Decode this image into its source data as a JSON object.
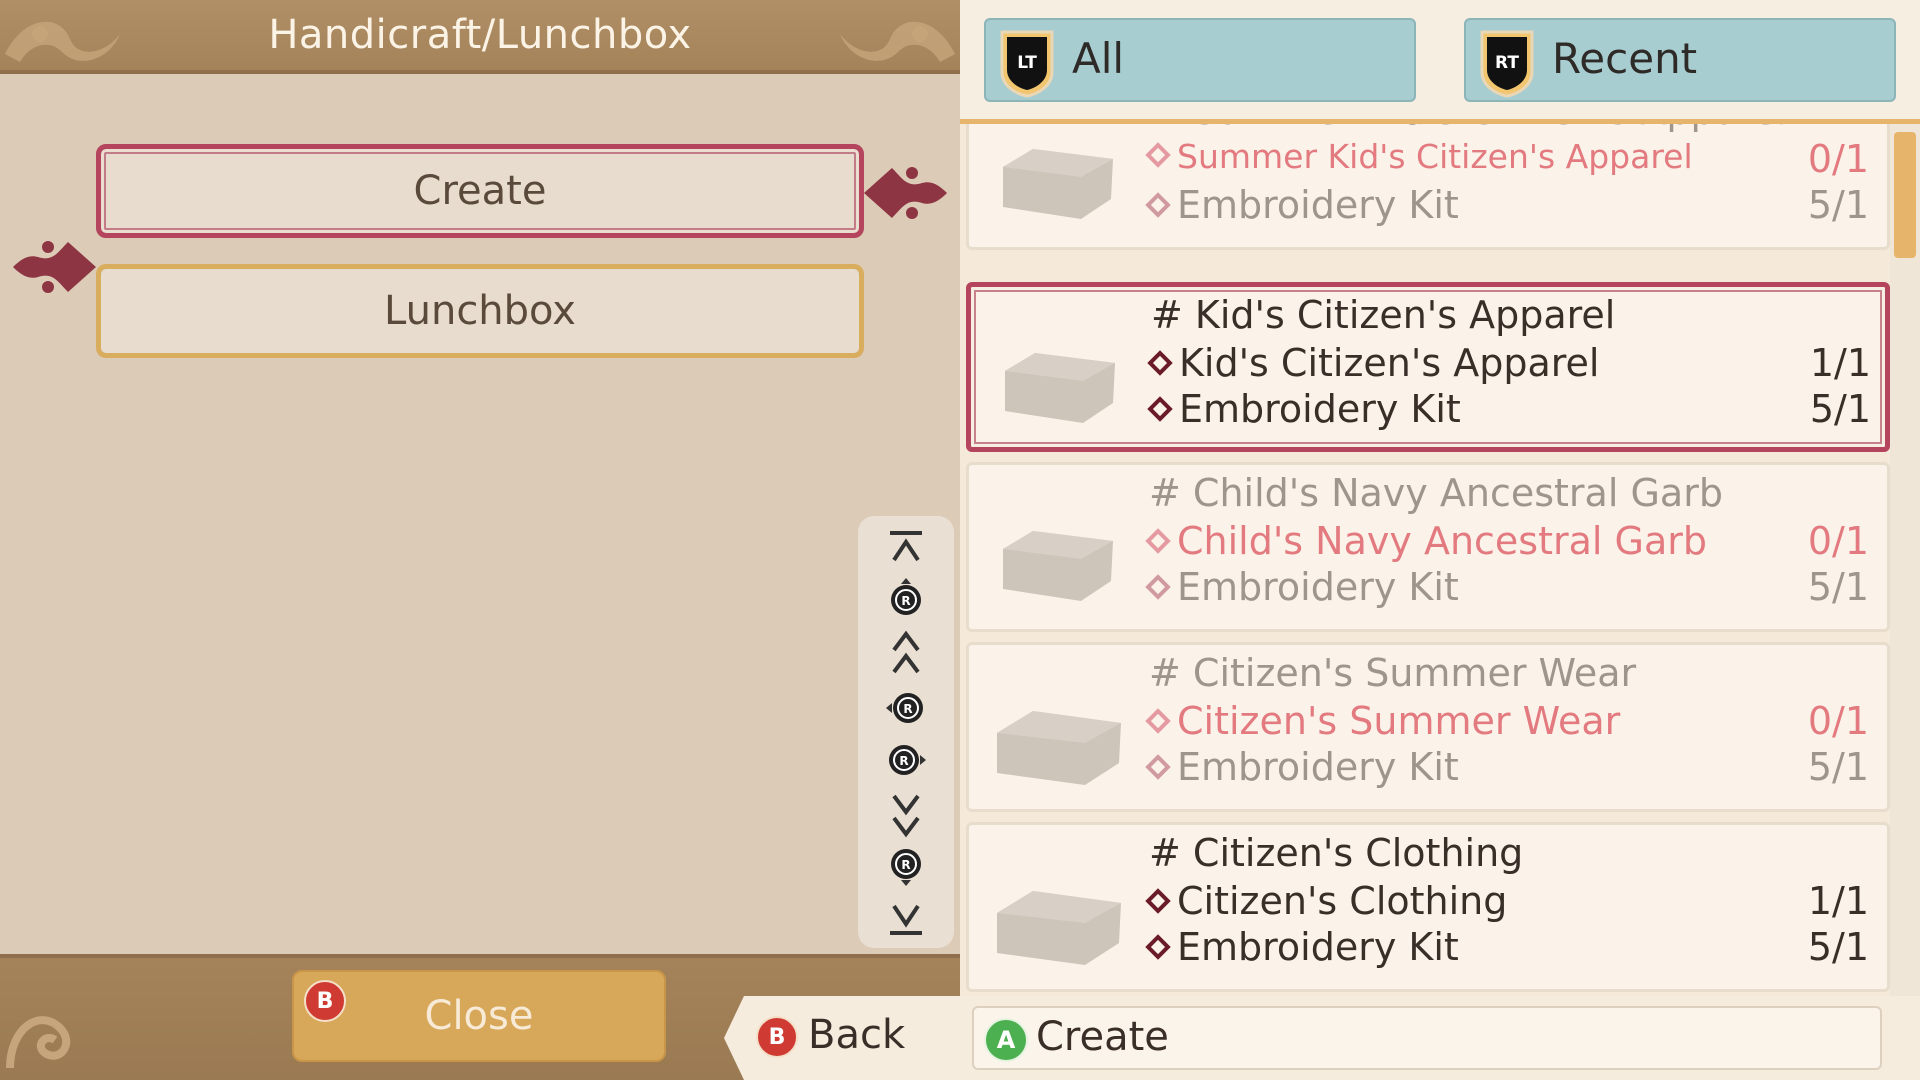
{
  "left": {
    "header_title": "Handicraft/Lunchbox",
    "menu": [
      {
        "label": "Create",
        "selected": true
      },
      {
        "label": "Lunchbox",
        "selected": false
      }
    ],
    "close_label": "Close",
    "close_badge": "B",
    "back_label": "Back",
    "back_badge": "B",
    "scroll_icons": [
      "scroll-top-icon",
      "r-stick-up-icon",
      "page-up-icon",
      "r-stick-left-icon",
      "r-stick-right-icon",
      "page-down-icon",
      "r-stick-down-icon",
      "scroll-bottom-icon"
    ]
  },
  "right": {
    "tabs": [
      {
        "badge": "LT",
        "label": "All"
      },
      {
        "badge": "RT",
        "label": "Recent"
      }
    ],
    "recipes": [
      {
        "title": "# Summer Kid's Citizen's Apparel",
        "output": "Summer Kid's Citizen's Apparel",
        "output_qty": "0/1",
        "material": "Embroidery Kit",
        "material_qty": "5/1",
        "state": "unavailable"
      },
      {
        "title": "# Kid's Citizen's Apparel",
        "output": "Kid's Citizen's Apparel",
        "output_qty": "1/1",
        "material": "Embroidery Kit",
        "material_qty": "5/1",
        "state": "selected"
      },
      {
        "title": "# Child's Navy Ancestral Garb",
        "output": "Child's Navy Ancestral Garb",
        "output_qty": "0/1",
        "material": "Embroidery Kit",
        "material_qty": "5/1",
        "state": "unavailable"
      },
      {
        "title": "# Citizen's Summer Wear",
        "output": "Citizen's Summer Wear",
        "output_qty": "0/1",
        "material": "Embroidery Kit",
        "material_qty": "5/1",
        "state": "unavailable"
      },
      {
        "title": "# Citizen's Clothing",
        "output": "Citizen's Clothing",
        "output_qty": "1/1",
        "material": "Embroidery Kit",
        "material_qty": "5/1",
        "state": "available"
      }
    ],
    "create_label": "Create",
    "create_badge": "A"
  },
  "colors": {
    "accent_selected": "#b4455d",
    "accent_gold": "#e6b46a",
    "tab_blue": "#a8cdd0",
    "missing_red": "#e37a80"
  }
}
